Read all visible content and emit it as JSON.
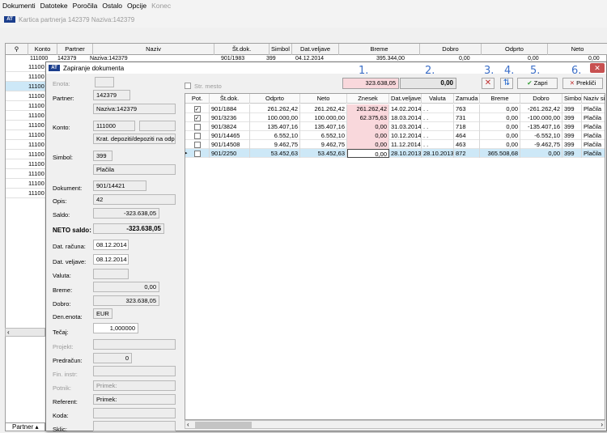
{
  "menu": [
    "Dokumenti",
    "Datoteke",
    "Poročila",
    "Ostalo",
    "Opcije",
    "Konec"
  ],
  "bg": {
    "title": "Kartica partnerja 142379   Naziva:142379",
    "headers": [
      "Konto",
      "Partner",
      "Naziv",
      "Št.dok.",
      "Simbol",
      "Dat.veljave",
      "Breme",
      "Dobro",
      "Odprto",
      "Neto"
    ],
    "first_row": {
      "konto": "111000",
      "partner": "142379",
      "naziv": "Naziva:142379",
      "stdok": "901/1983",
      "simbol": "399",
      "dat": "04.12.2014",
      "breme": "395.344,00",
      "dobro": "0,00",
      "odprto": "0,00",
      "neto": "0,00"
    },
    "konto_rows": [
      "11100",
      "11100",
      "11100",
      "11100",
      "11100",
      "11100",
      "11100",
      "11100",
      "11100",
      "11100",
      "11100",
      "11100",
      "11100",
      "11100"
    ],
    "bottom_tab": "Partner"
  },
  "dialog": {
    "title": "Zapiranje dokumenta",
    "close": "✕",
    "labels": {
      "enota": "Enota:",
      "partner": "Partner:",
      "konto": "Konto:",
      "simbol": "Simbol:",
      "dokument": "Dokument:",
      "opis": "Opis:",
      "saldo": "Saldo:",
      "neto_saldo": "NETO saldo:",
      "dat_racuna": "Dat. računa:",
      "dat_veljave": "Dat. veljave:",
      "valuta": "Valuta:",
      "breme": "Breme:",
      "dobro": "Dobro:",
      "den_enota": "Den.enota:",
      "tecaj": "Tečaj:",
      "projekt": "Projekt:",
      "predracun": "Predračun:",
      "fin_instr": "Fin. instr:",
      "potnik": "Potnik:",
      "referent": "Referent:",
      "koda": "Koda:",
      "sklic": "Sklic:",
      "str_mesto": "Str. mesto"
    },
    "values": {
      "partner_code": "142379",
      "partner_name": "Naziva:142379",
      "konto": "111000",
      "konto_desc": "Krat. depoziti/depoziti na odpoklic",
      "simbol": "399",
      "simbol_name": "Plačila",
      "dokument": "901/14421",
      "opis": "42",
      "saldo": "-323.638,05",
      "neto_saldo": "-323.638,05",
      "dat_racuna": "08.12.2014",
      "dat_veljave": "08.12.2014",
      "breme": "0,00",
      "dobro": "323.638,05",
      "den_enota": "EUR",
      "tecaj": "1,000000",
      "predracun": "0",
      "potnik": "Primek:",
      "referent": "Primek:"
    },
    "top": {
      "amount1": "323.638,05",
      "amount2": "0,00",
      "btn_zapri": "Zapri",
      "btn_preklici": "Prekliči"
    },
    "markers": [
      "1.",
      "2.",
      "3.",
      "4.",
      "5.",
      "6."
    ],
    "grid": {
      "headers": [
        "Pot.",
        "Št.dok.",
        "Odprto",
        "Neto",
        "Znesek",
        "Dat.veljave",
        "Valuta",
        "Zamuda",
        "Breme",
        "Dobro",
        "Simbol",
        "Naziv simbola"
      ],
      "rows": [
        {
          "pot": true,
          "stdok": "901/1884",
          "odprto": "261.262,42",
          "neto": "261.262,42",
          "znesek": "261.262,42",
          "dat": "14.02.2014",
          "valuta": ". .",
          "zamuda": "763",
          "breme": "0,00",
          "dobro": "-261.262,42",
          "simbol": "399",
          "naziv": "Plačila"
        },
        {
          "pot": true,
          "stdok": "901/3236",
          "odprto": "100.000,00",
          "neto": "100.000,00",
          "znesek": "62.375,63",
          "dat": "18.03.2014",
          "valuta": ". .",
          "zamuda": "731",
          "breme": "0,00",
          "dobro": "-100.000,00",
          "simbol": "399",
          "naziv": "Plačila"
        },
        {
          "pot": false,
          "stdok": "901/3824",
          "odprto": "135.407,16",
          "neto": "135.407,16",
          "znesek": "0,00",
          "dat": "31.03.2014",
          "valuta": ". .",
          "zamuda": "718",
          "breme": "0,00",
          "dobro": "-135.407,16",
          "simbol": "399",
          "naziv": "Plačila"
        },
        {
          "pot": false,
          "stdok": "901/14465",
          "odprto": "6.552,10",
          "neto": "6.552,10",
          "znesek": "0,00",
          "dat": "10.12.2014",
          "valuta": ". .",
          "zamuda": "464",
          "breme": "0,00",
          "dobro": "-6.552,10",
          "simbol": "399",
          "naziv": "Plačila"
        },
        {
          "pot": false,
          "stdok": "901/14508",
          "odprto": "9.462,75",
          "neto": "9.462,75",
          "znesek": "0,00",
          "dat": "11.12.2014",
          "valuta": ". .",
          "zamuda": "463",
          "breme": "0,00",
          "dobro": "-9.462,75",
          "simbol": "399",
          "naziv": "Plačila"
        },
        {
          "pot": false,
          "stdok": "901/2250",
          "odprto": "53.452,63",
          "neto": "53.452,63",
          "znesek": "0,00",
          "dat": "28.10.2013",
          "valuta": "28.10.2013",
          "zamuda": "872",
          "breme": "365.508,68",
          "dobro": "0,00",
          "simbol": "399",
          "naziv": "Plačila"
        }
      ]
    }
  }
}
